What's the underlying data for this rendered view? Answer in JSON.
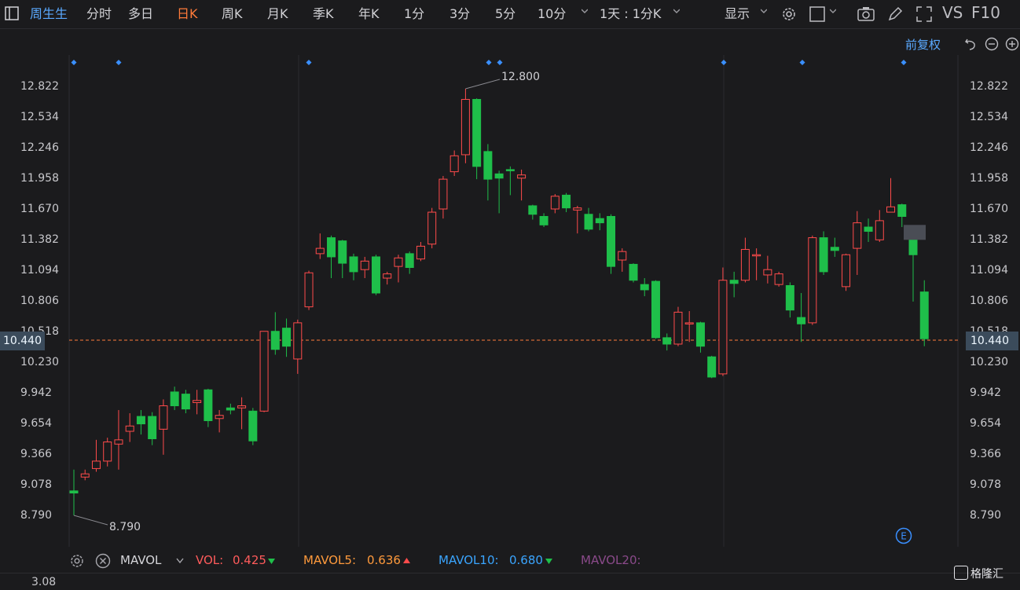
{
  "toolbar": {
    "stock_name": "周生生",
    "tabs": [
      "分时",
      "多日",
      "日K",
      "周K",
      "月K",
      "季K",
      "年K",
      "1分",
      "3分",
      "5分",
      "10分"
    ],
    "active_tab": "日K",
    "compare_label": "1天 : 1分K",
    "display_label": "显示",
    "vs_label": "VS",
    "f10_label": "F10"
  },
  "chart_header": {
    "adjust_label": "前复权"
  },
  "y_axis": {
    "labels": [
      "12.822",
      "12.534",
      "12.246",
      "11.958",
      "11.670",
      "11.382",
      "11.094",
      "10.806",
      "10.518",
      "10.230",
      "9.942",
      "9.654",
      "9.366",
      "9.078",
      "8.790"
    ],
    "current_price": "10.440"
  },
  "annotations": {
    "high": "12.800",
    "low": "8.790"
  },
  "volume_bar": {
    "indicator": "MAVOL",
    "vol_label": "VOL:",
    "vol_value": "0.425",
    "mavol5_label": "MAVOL5:",
    "mavol5_value": "0.636",
    "mavol10_label": "MAVOL10:",
    "mavol10_value": "0.680",
    "mavol20_label": "MAVOL20:",
    "vol_axis_label": "3.08",
    "colors": {
      "vol": "#ff5b5b",
      "mavol5": "#ff9a3c",
      "mavol10": "#3aa5ff",
      "mavol20": "#8a4a8a"
    }
  },
  "logo": "格隆汇",
  "colors": {
    "up": "#ff4b4b",
    "down": "#1fbf4a",
    "accent": "#5aa9ff",
    "active": "#ff7b3a"
  },
  "chart_data": {
    "type": "candlestick",
    "ylim": [
      8.6,
      13.05
    ],
    "candles": [
      {
        "o": 9.02,
        "c": 9.0,
        "h": 9.22,
        "l": 8.79
      },
      {
        "o": 9.15,
        "c": 9.18,
        "h": 9.22,
        "l": 9.12
      },
      {
        "o": 9.23,
        "c": 9.3,
        "h": 9.5,
        "l": 9.2
      },
      {
        "o": 9.3,
        "c": 9.48,
        "h": 9.52,
        "l": 9.25
      },
      {
        "o": 9.46,
        "c": 9.5,
        "h": 9.78,
        "l": 9.22
      },
      {
        "o": 9.58,
        "c": 9.63,
        "h": 9.75,
        "l": 9.48
      },
      {
        "o": 9.72,
        "c": 9.65,
        "h": 9.78,
        "l": 9.55
      },
      {
        "o": 9.72,
        "c": 9.51,
        "h": 9.76,
        "l": 9.45
      },
      {
        "o": 9.6,
        "c": 9.82,
        "h": 9.88,
        "l": 9.36
      },
      {
        "o": 9.95,
        "c": 9.82,
        "h": 10.0,
        "l": 9.78
      },
      {
        "o": 9.93,
        "c": 9.79,
        "h": 9.97,
        "l": 9.75
      },
      {
        "o": 9.85,
        "c": 9.87,
        "h": 9.97,
        "l": 9.74
      },
      {
        "o": 9.97,
        "c": 9.68,
        "h": 9.98,
        "l": 9.62
      },
      {
        "o": 9.7,
        "c": 9.73,
        "h": 9.78,
        "l": 9.57
      },
      {
        "o": 9.8,
        "c": 9.78,
        "h": 9.84,
        "l": 9.74
      },
      {
        "o": 9.8,
        "c": 9.82,
        "h": 9.9,
        "l": 9.6
      },
      {
        "o": 9.77,
        "c": 9.49,
        "h": 9.8,
        "l": 9.45
      },
      {
        "o": 9.77,
        "c": 10.52,
        "h": 10.52,
        "l": 9.76
      },
      {
        "o": 10.52,
        "c": 10.35,
        "h": 10.7,
        "l": 10.3
      },
      {
        "o": 10.55,
        "c": 10.38,
        "h": 10.64,
        "l": 10.28
      },
      {
        "o": 10.26,
        "c": 10.6,
        "h": 10.63,
        "l": 10.12
      },
      {
        "o": 10.75,
        "c": 11.07,
        "h": 11.09,
        "l": 10.72
      },
      {
        "o": 11.25,
        "c": 11.3,
        "h": 11.44,
        "l": 11.2
      },
      {
        "o": 11.4,
        "c": 11.22,
        "h": 11.42,
        "l": 11.02
      },
      {
        "o": 11.37,
        "c": 11.16,
        "h": 11.38,
        "l": 11.02
      },
      {
        "o": 11.22,
        "c": 11.08,
        "h": 11.25,
        "l": 11.0
      },
      {
        "o": 11.1,
        "c": 11.18,
        "h": 11.22,
        "l": 11.02
      },
      {
        "o": 11.22,
        "c": 10.88,
        "h": 11.24,
        "l": 10.86
      },
      {
        "o": 11.02,
        "c": 11.06,
        "h": 11.08,
        "l": 10.96
      },
      {
        "o": 11.13,
        "c": 11.21,
        "h": 11.24,
        "l": 10.98
      },
      {
        "o": 11.25,
        "c": 11.12,
        "h": 11.27,
        "l": 11.06
      },
      {
        "o": 11.2,
        "c": 11.32,
        "h": 11.36,
        "l": 11.18
      },
      {
        "o": 11.34,
        "c": 11.64,
        "h": 11.68,
        "l": 11.3
      },
      {
        "o": 11.67,
        "c": 11.95,
        "h": 11.98,
        "l": 11.58
      },
      {
        "o": 12.02,
        "c": 12.17,
        "h": 12.22,
        "l": 11.98
      },
      {
        "o": 12.18,
        "c": 12.7,
        "h": 12.8,
        "l": 12.1
      },
      {
        "o": 12.7,
        "c": 12.07,
        "h": 12.71,
        "l": 11.95
      },
      {
        "o": 12.21,
        "c": 11.95,
        "h": 12.28,
        "l": 11.75
      },
      {
        "o": 12.0,
        "c": 11.96,
        "h": 12.03,
        "l": 11.63
      },
      {
        "o": 12.04,
        "c": 12.03,
        "h": 12.07,
        "l": 11.8
      },
      {
        "o": 11.96,
        "c": 11.99,
        "h": 12.04,
        "l": 11.75
      },
      {
        "o": 11.7,
        "c": 11.62,
        "h": 11.71,
        "l": 11.57
      },
      {
        "o": 11.6,
        "c": 11.52,
        "h": 11.63,
        "l": 11.5
      },
      {
        "o": 11.67,
        "c": 11.79,
        "h": 11.81,
        "l": 11.63
      },
      {
        "o": 11.8,
        "c": 11.68,
        "h": 11.82,
        "l": 11.64
      },
      {
        "o": 11.66,
        "c": 11.68,
        "h": 11.7,
        "l": 11.44
      },
      {
        "o": 11.62,
        "c": 11.48,
        "h": 11.68,
        "l": 11.46
      },
      {
        "o": 11.58,
        "c": 11.54,
        "h": 11.63,
        "l": 11.47
      },
      {
        "o": 11.6,
        "c": 11.13,
        "h": 11.62,
        "l": 11.06
      },
      {
        "o": 11.19,
        "c": 11.27,
        "h": 11.3,
        "l": 11.08
      },
      {
        "o": 11.15,
        "c": 11.0,
        "h": 11.16,
        "l": 10.98
      },
      {
        "o": 10.96,
        "c": 10.91,
        "h": 11.02,
        "l": 10.85
      },
      {
        "o": 10.99,
        "c": 10.46,
        "h": 11.0,
        "l": 10.45
      },
      {
        "o": 10.46,
        "c": 10.4,
        "h": 10.5,
        "l": 10.34
      },
      {
        "o": 10.4,
        "c": 10.7,
        "h": 10.75,
        "l": 10.38
      },
      {
        "o": 10.6,
        "c": 10.6,
        "h": 10.71,
        "l": 10.42
      },
      {
        "o": 10.6,
        "c": 10.38,
        "h": 10.61,
        "l": 10.32
      },
      {
        "o": 10.28,
        "c": 10.09,
        "h": 10.29,
        "l": 10.08
      },
      {
        "o": 10.12,
        "c": 11.0,
        "h": 11.12,
        "l": 10.1
      },
      {
        "o": 11.0,
        "c": 10.97,
        "h": 11.08,
        "l": 10.84
      },
      {
        "o": 11.0,
        "c": 11.29,
        "h": 11.4,
        "l": 10.98
      },
      {
        "o": 11.24,
        "c": 11.24,
        "h": 11.3,
        "l": 11.0
      },
      {
        "o": 11.05,
        "c": 11.1,
        "h": 11.23,
        "l": 10.97
      },
      {
        "o": 10.96,
        "c": 11.06,
        "h": 11.08,
        "l": 10.94
      },
      {
        "o": 10.95,
        "c": 10.72,
        "h": 10.98,
        "l": 10.65
      },
      {
        "o": 10.65,
        "c": 10.59,
        "h": 10.88,
        "l": 10.42
      },
      {
        "o": 10.6,
        "c": 11.4,
        "h": 11.42,
        "l": 10.58
      },
      {
        "o": 11.4,
        "c": 11.08,
        "h": 11.46,
        "l": 11.05
      },
      {
        "o": 11.31,
        "c": 11.28,
        "h": 11.4,
        "l": 11.22
      },
      {
        "o": 10.94,
        "c": 11.24,
        "h": 11.25,
        "l": 10.9
      },
      {
        "o": 11.3,
        "c": 11.54,
        "h": 11.65,
        "l": 11.05
      },
      {
        "o": 11.5,
        "c": 11.46,
        "h": 11.58,
        "l": 11.36
      },
      {
        "o": 11.38,
        "c": 11.56,
        "h": 11.66,
        "l": 11.36
      },
      {
        "o": 11.64,
        "c": 11.69,
        "h": 11.96,
        "l": 11.64
      },
      {
        "o": 11.71,
        "c": 11.6,
        "h": 11.72,
        "l": 11.5
      },
      {
        "o": 11.39,
        "c": 11.24,
        "h": 11.4,
        "l": 10.8
      },
      {
        "o": 10.89,
        "c": 10.45,
        "h": 11.0,
        "l": 10.38
      }
    ],
    "pending_box": {
      "from": 11.52,
      "to": 11.38
    }
  }
}
